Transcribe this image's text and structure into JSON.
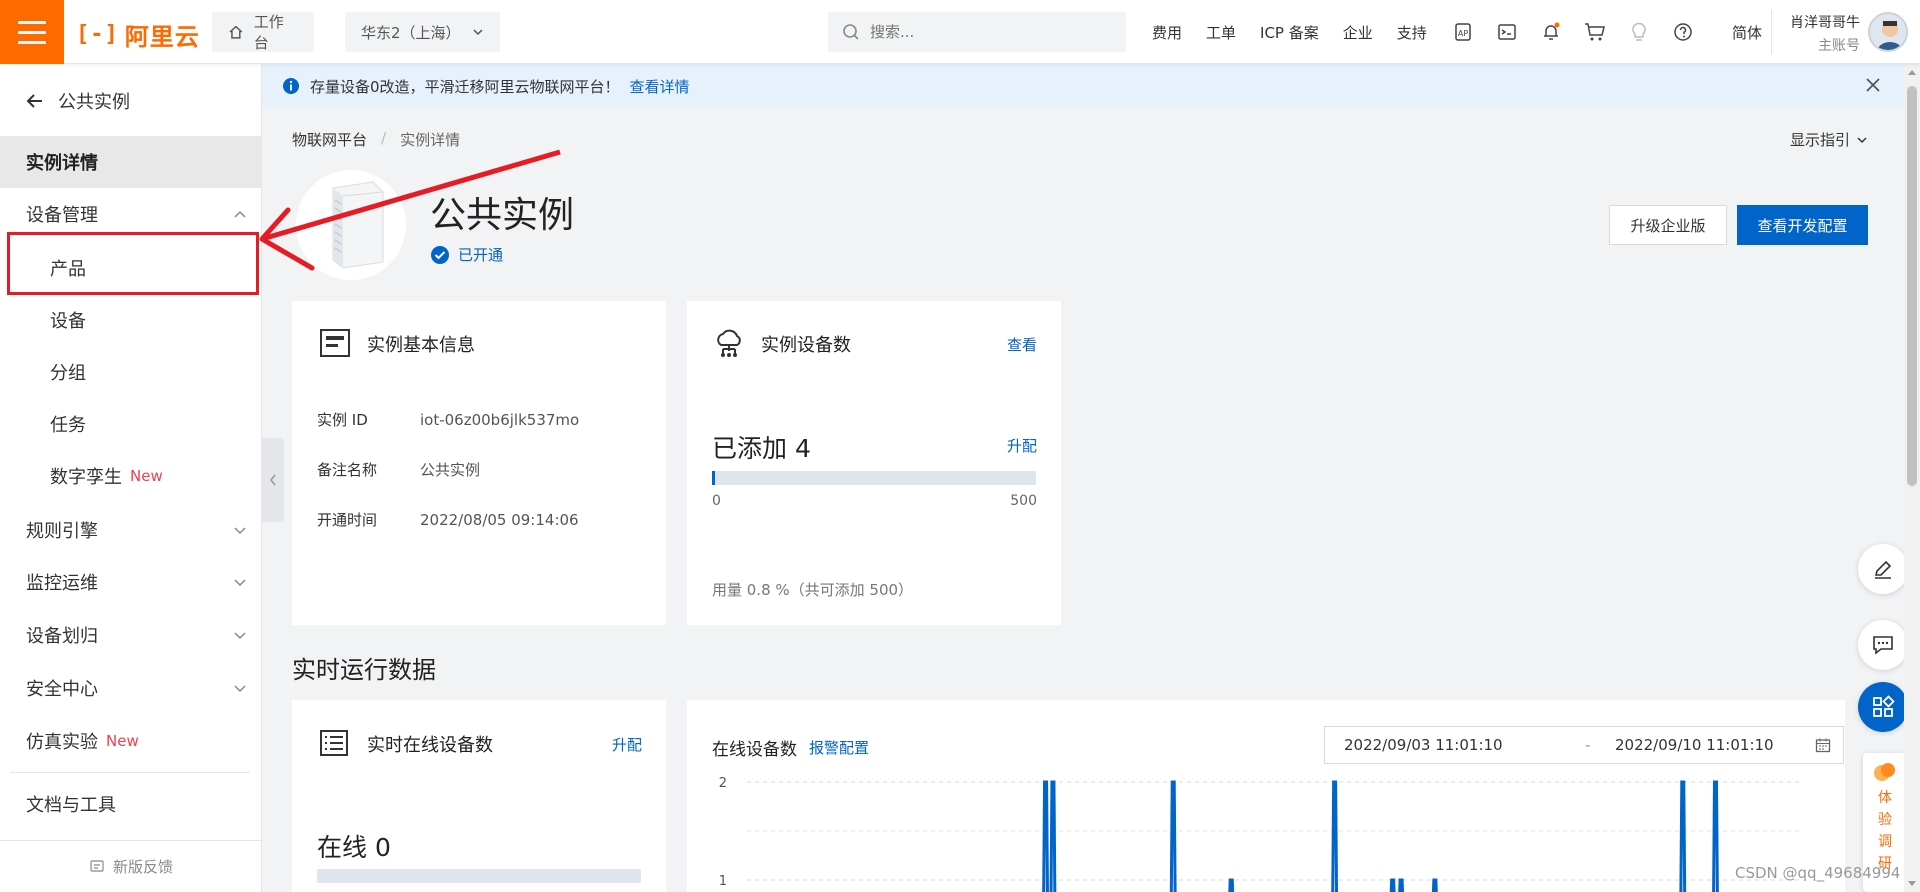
{
  "topbar": {
    "logo_text": "阿里云",
    "workbench_label": "工作台",
    "region_label": "华东2（上海）",
    "search_placeholder": "搜索...",
    "links": [
      "费用",
      "工单",
      "ICP 备案",
      "企业",
      "支持"
    ],
    "lang_label": "简体",
    "user_name": "肖洋哥哥牛",
    "user_sub": "主账号"
  },
  "sidebar": {
    "back_label": "公共实例",
    "items": [
      {
        "label": "实例详情",
        "active": true
      },
      {
        "label": "设备管理",
        "expanded": true
      },
      {
        "label": "产品",
        "sub": true
      },
      {
        "label": "设备",
        "sub": true
      },
      {
        "label": "分组",
        "sub": true
      },
      {
        "label": "任务",
        "sub": true
      },
      {
        "label": "数字孪生",
        "sub": true,
        "badge": "New"
      },
      {
        "label": "规则引擎"
      },
      {
        "label": "监控运维"
      },
      {
        "label": "设备划归"
      },
      {
        "label": "安全中心"
      },
      {
        "label": "仿真实验",
        "badge": "New"
      },
      {
        "label": "文档与工具"
      }
    ],
    "feedback_label": "新版反馈"
  },
  "notice": {
    "text": "存量设备0改造，平滑迁移阿里云物联网平台！",
    "link": "查看详情"
  },
  "breadcrumb": {
    "root": "物联网平台",
    "sep": "/",
    "current": "实例详情"
  },
  "guide_label": "显示指引",
  "instance": {
    "title": "公共实例",
    "status": "已开通",
    "upgrade_button": "升级企业版",
    "config_button": "查看开发配置"
  },
  "basic_info": {
    "title": "实例基本信息",
    "rows": [
      {
        "key": "实例 ID",
        "value": "iot-06z00b6jlk537mo"
      },
      {
        "key": "备注名称",
        "value": "公共实例"
      },
      {
        "key": "开通时间",
        "value": "2022/08/05 09:14:06"
      }
    ]
  },
  "device_count": {
    "title": "实例设备数",
    "view_link": "查看",
    "added_label": "已添加 4",
    "upgrade_link": "升配",
    "progress_fraction": 0.008,
    "min_label": "0",
    "max_label": "500",
    "usage_text": "用量 0.8 %（共可添加 500）"
  },
  "realtime": {
    "section_title": "实时运行数据",
    "online_card_title": "实时在线设备数",
    "online_card_link": "升配",
    "online_value": "在线 0",
    "chart_title": "在线设备数",
    "chart_link": "报警配置",
    "date_start": "2022/09/03 11:01:10",
    "date_dash": "-",
    "date_end": "2022/09/10 11:01:10"
  },
  "survey_label": [
    "体",
    "验",
    "调",
    "研"
  ],
  "watermark": "CSDN @qq_49684994",
  "colors": {
    "brand_orange": "#ff6a00",
    "primary_blue": "#0064c8",
    "annotation_red": "#e51c23",
    "new_badge_red": "#f0404b"
  },
  "chart_data": {
    "type": "line",
    "title": "在线设备数",
    "y_ticks": [
      "2",
      "1"
    ],
    "ylim": [
      0,
      2
    ],
    "x_range": [
      "2022/09/03 11:01:10",
      "2022/09/10 11:01:10"
    ],
    "series": [
      {
        "spikes_x": [
          0.283,
          0.29,
          0.404,
          0.459,
          0.557,
          0.612,
          0.62,
          0.652,
          0.887,
          0.918
        ],
        "spikes_y": [
          2,
          2,
          2,
          1,
          2,
          1,
          1,
          1,
          2,
          2
        ]
      }
    ]
  }
}
